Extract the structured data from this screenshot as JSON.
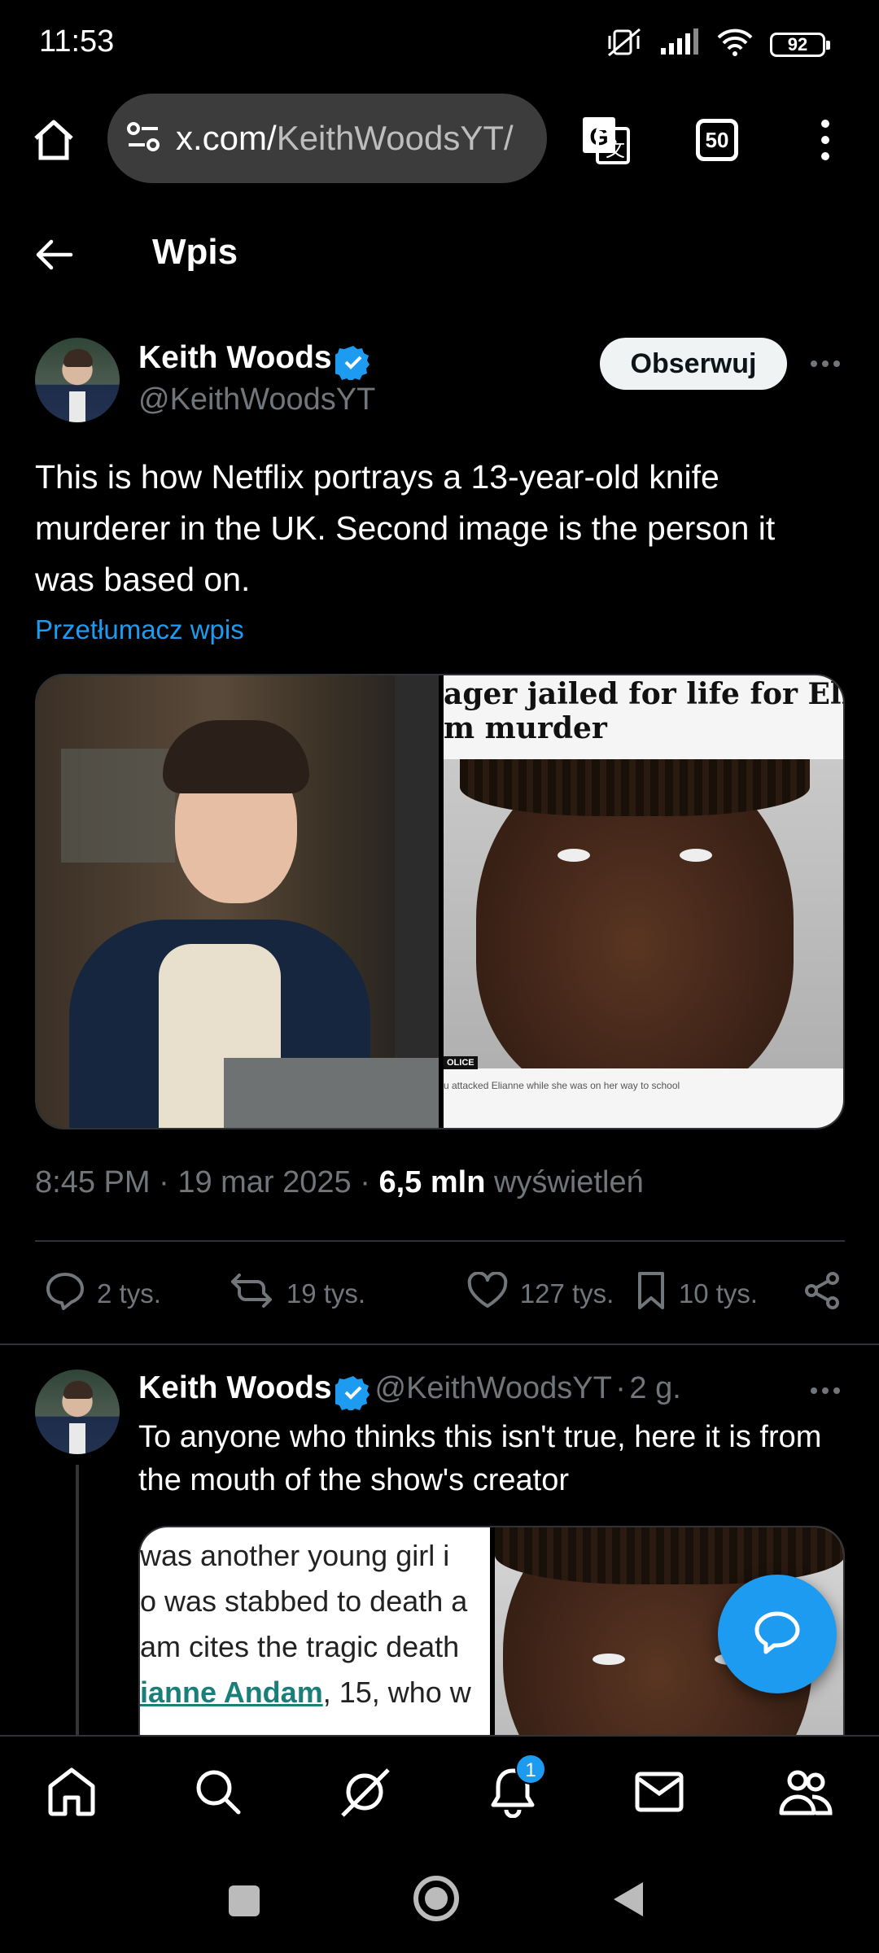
{
  "status_bar": {
    "time": "11:53",
    "battery": "92",
    "icons": [
      "mute-vibrate-icon",
      "signal-icon",
      "wifi-icon",
      "battery-icon"
    ]
  },
  "browser": {
    "url_host": "x.com/",
    "url_path": "KeithWoodsYT/",
    "tab_count": "50",
    "icons": [
      "home-icon",
      "site-settings-icon",
      "translate-icon",
      "tabs-icon",
      "more-vert-icon"
    ]
  },
  "header": {
    "title": "Wpis"
  },
  "tweet": {
    "author_name": "Keith Woods",
    "author_handle": "@KeithWoodsYT",
    "follow_label": "Obserwuj",
    "text": "This is how Netflix portrays a 13-year-old knife murderer in the UK. Second image is the person it was based on.",
    "translate_label": "Przetłumacz wpis",
    "media": {
      "headline_line1": "ager jailed for life for Elian",
      "headline_line2": "m murder",
      "police_tag": "OLICE",
      "caption": "u attacked Elianne while she was on her way to school"
    },
    "time": "8:45 PM",
    "date": "19 mar 2025",
    "views_count": "6,5 mln",
    "views_label": "wyświetleń",
    "stats": {
      "replies": "2 tys.",
      "reposts": "19 tys.",
      "likes": "127 tys.",
      "bookmarks": "10 tys."
    }
  },
  "reply": {
    "author_name": "Keith Woods",
    "author_handle": "@KeithWoodsYT",
    "age": "2 g.",
    "text": "To anyone who thinks this isn't true, here it is from the mouth of the show's creator",
    "media_lines": [
      " was another young girl i",
      "o was stabbed to death a",
      "am cites the tragic death"
    ],
    "media_link": "ianne Andam",
    "media_after_link": ", 15, who w"
  },
  "bottom_nav": {
    "items": [
      "home-icon",
      "search-icon",
      "grok-icon",
      "notifications-icon",
      "messages-icon",
      "communities-icon"
    ],
    "notification_count": "1"
  },
  "colors": {
    "accent": "#1d9bf0",
    "background": "#000000",
    "muted": "#71767b"
  }
}
